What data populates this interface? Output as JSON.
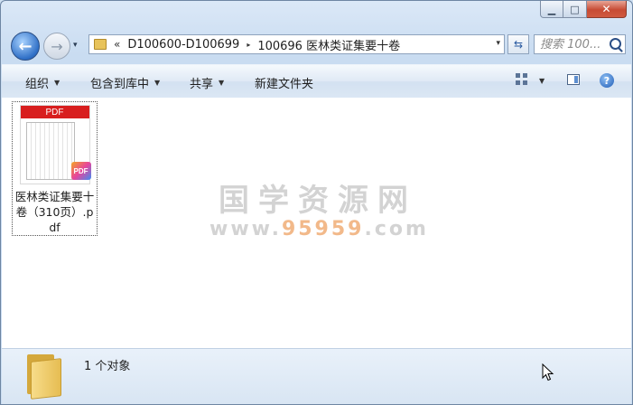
{
  "window": {
    "caption_buttons": {
      "minimize": "▁",
      "maximize": "□",
      "close": "✕"
    }
  },
  "navigation": {
    "back_glyph": "←",
    "forward_glyph": "→",
    "history_glyph": "▾"
  },
  "address_bar": {
    "overflow_chevron": "«",
    "breadcrumbs": [
      "D100600-D100699",
      "100696 医林类证集要十卷"
    ],
    "separator": "▸",
    "dropdown": "▾"
  },
  "refresh": {
    "glyph": "⇆"
  },
  "search": {
    "placeholder": "搜索 100..."
  },
  "command_bar": {
    "organize": "组织",
    "include_in_library": "包含到库中",
    "share": "共享",
    "new_folder": "新建文件夹",
    "caret": "▼",
    "help": "?"
  },
  "files": [
    {
      "name": "医林类证集要十卷（310页）.pdf",
      "thumbnail_header": "PDF",
      "badge": "PDF"
    }
  ],
  "watermark": {
    "title": "国学资源网",
    "url_prefix": "www.",
    "url_number": "95959",
    "url_suffix": ".com"
  },
  "status_bar": {
    "text": "1 个对象"
  },
  "colors": {
    "pdf_red": "#d81e1e",
    "window_chrome": "#c9dcf1",
    "close_button": "#c74b34"
  }
}
